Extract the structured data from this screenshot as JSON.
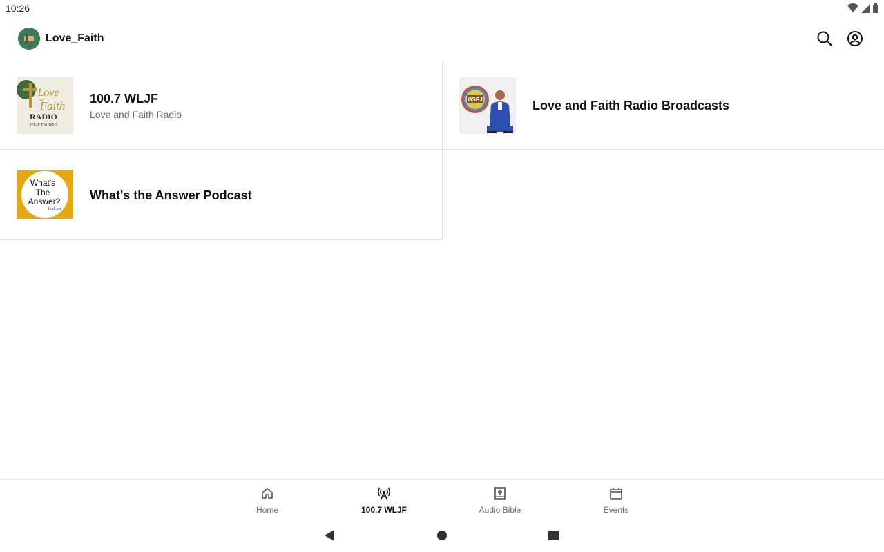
{
  "status_bar": {
    "time": "10:26"
  },
  "app_bar": {
    "title": "Love_Faith"
  },
  "cards": [
    {
      "title": "100.7 WLJF",
      "subtitle": "Love and Faith Radio",
      "thumb_text": {
        "line1": "Love",
        "line2": "and",
        "line3": "Faith",
        "line4": "RADIO",
        "line5": "WLJF FM 100.7"
      }
    },
    {
      "title": "Love and Faith Radio Broadcasts",
      "thumb_text": {
        "badge": "GSPJ"
      }
    },
    {
      "title": "What's the Answer Podcast",
      "thumb_text": {
        "line1": "What's",
        "line2": "The",
        "line3": "Answer?",
        "line4": "Podcast"
      }
    }
  ],
  "bottom_nav": [
    {
      "label": "Home",
      "icon": "home-icon",
      "active": false
    },
    {
      "label": "100.7 WLJF",
      "icon": "radio-tower-icon",
      "active": true
    },
    {
      "label": "Audio Bible",
      "icon": "bible-icon",
      "active": false
    },
    {
      "label": "Events",
      "icon": "calendar-icon",
      "active": false
    }
  ],
  "colors": {
    "accent": "#111111",
    "divider": "#e3e3e3",
    "muted": "#6b6b6b",
    "podcast_yellow": "#e5a812"
  }
}
